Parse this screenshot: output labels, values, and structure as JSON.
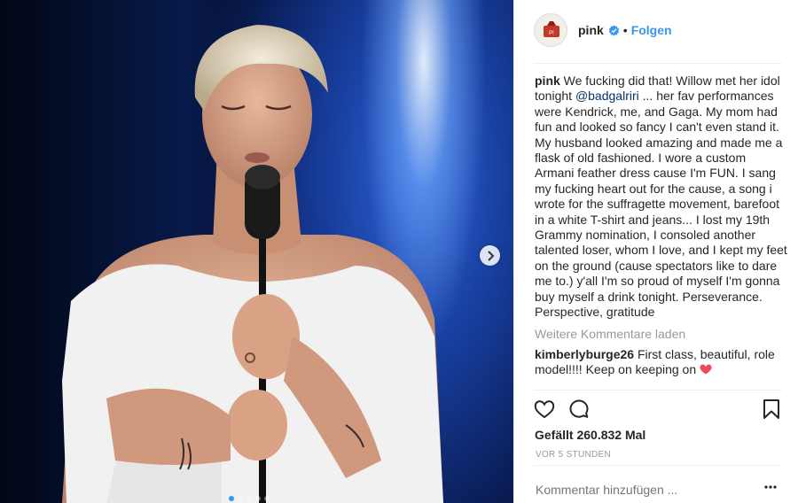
{
  "post": {
    "username": "pink",
    "bullet": "•",
    "follow_label": "Folgen",
    "caption_user": "pink",
    "caption_text_1": "We fucking did that! Willow met her idol tonight ",
    "caption_mention": "@badgalriri",
    "caption_text_2": " ... her fav performances were Kendrick, me, and Gaga. My mom had fun and looked so fancy I can't even stand it. My husband looked amazing and made me a flask of old fashioned. I wore a custom Armani feather dress cause I'm FUN. I sang my fucking heart out for the cause, a song i wrote for the suffragette movement, barefoot in a white T-shirt and jeans... I lost my 19th Grammy nomination, I consoled another talented loser, whom I love, and I kept my feet on the ground (cause spectators like to dare me to.) y'all I'm so proud of myself I'm gonna buy myself a drink tonight. Perseverance. Perspective, gratitude",
    "load_more_label": "Weitere Kommentare laden",
    "comments": [
      {
        "user": "kimberlyburge26",
        "text": "First class, beautiful, role model!!!! Keep on keeping on "
      }
    ],
    "likes_text": "Gefällt 260.832 Mal",
    "time_text": "VOR 5 STUNDEN",
    "add_comment_placeholder": "Kommentar hinzufügen ..."
  },
  "colors": {
    "accent": "#3897f0",
    "mention": "#003569",
    "muted": "#999999",
    "heart": "#ed4956"
  },
  "icons": {
    "verified": "verified-badge-icon",
    "like": "heart-outline-icon",
    "comment": "comment-bubble-icon",
    "save": "bookmark-icon",
    "next": "chevron-right-icon",
    "options": "more-options-icon"
  },
  "carousel": {
    "count": 5,
    "active_index": 0
  }
}
